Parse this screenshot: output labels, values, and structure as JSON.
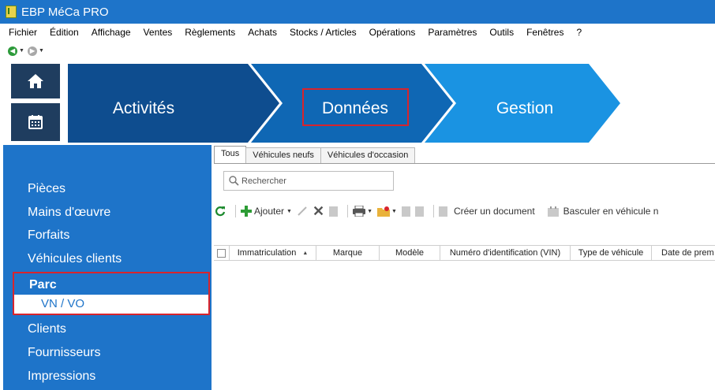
{
  "window": {
    "title": "EBP MéCa PRO"
  },
  "menu": [
    "Fichier",
    "Édition",
    "Affichage",
    "Ventes",
    "Règlements",
    "Achats",
    "Stocks / Articles",
    "Opérations",
    "Paramètres",
    "Outils",
    "Fenêtres",
    "?"
  ],
  "ribbon": {
    "steps": [
      {
        "label": "Activités",
        "color": "#0e4d8f"
      },
      {
        "label": "Données",
        "color": "#0f67b4"
      },
      {
        "label": "Gestion",
        "color": "#1a93e2"
      }
    ]
  },
  "sidebar": {
    "items": [
      "Pièces",
      "Mains d'œuvre",
      "Forfaits",
      "Véhicules clients"
    ],
    "selected_group": "Parc",
    "selected_item": "VN / VO",
    "items_after": [
      "Clients",
      "Fournisseurs",
      "Impressions"
    ]
  },
  "tabs": [
    "Tous",
    "Véhicules neufs",
    "Véhicules d'occasion"
  ],
  "search": {
    "placeholder": "Rechercher"
  },
  "toolbar": {
    "add": "Ajouter",
    "create_doc": "Créer un document",
    "switch": "Basculer en véhicule n"
  },
  "grid": {
    "columns": [
      "Immatriculation",
      "Marque",
      "Modèle",
      "Numéro d'identification (VIN)",
      "Type de véhicule",
      "Date de prem"
    ]
  },
  "colors": {
    "titlebar": "#1e74c9",
    "sidebar": "#1e74c9",
    "highlight": "#d8242c",
    "home_buttons": "#1f3d5f"
  }
}
